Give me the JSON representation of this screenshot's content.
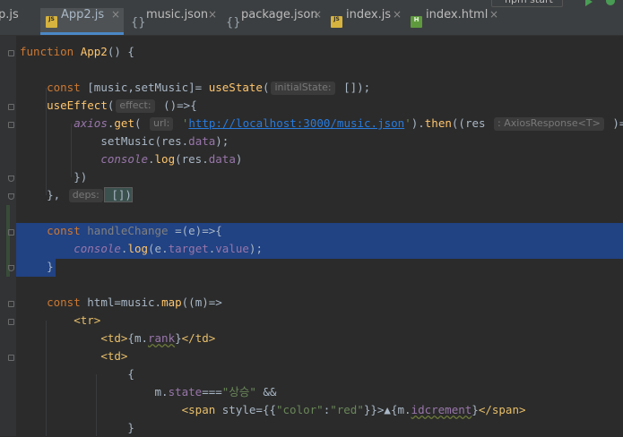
{
  "toolbar": {
    "run_config_label": "npm start"
  },
  "tabs": [
    {
      "label": "p.js",
      "icon": "js-file-icon",
      "active": false
    },
    {
      "label": "App2.js",
      "icon": "js-file-icon",
      "active": true
    },
    {
      "label": "music.json",
      "icon": "json-file-icon",
      "active": false
    },
    {
      "label": "package.json",
      "icon": "json-file-icon",
      "active": false
    },
    {
      "label": "index.js",
      "icon": "js-file-icon",
      "active": false
    },
    {
      "label": "index.html",
      "icon": "html-file-icon",
      "active": false
    }
  ],
  "tab_close_glyph": "×",
  "code": {
    "l1": {
      "kw": "function ",
      "fn": "App2",
      "rest": "() {"
    },
    "l3": {
      "kw": "const ",
      "vars": "[music,setMusic]= ",
      "fn": "useState",
      "open": "(",
      "hint": "initialState:",
      "rest": " []);"
    },
    "l4": {
      "fn": "useEffect",
      "open": "(",
      "hint": "effect:",
      "rest": " ()=>{"
    },
    "l5": {
      "obj": "axios",
      "dot": ".",
      "fn": "get",
      "open": "( ",
      "hint1": "url:",
      "q1": " '",
      "url": "http://localhost:3000/music.json",
      "q2": "'",
      "mid": ").",
      "fn2": "then",
      "mid2": "((res ",
      "hint2": ": AxiosResponse<T>",
      "rest": " )=>{"
    },
    "l6": {
      "call": "setMusic",
      "open": "(res.",
      "prop": "data",
      "rest": ");"
    },
    "l7": {
      "obj": "console",
      "dot": ".",
      "call": "log",
      "open": "(res.",
      "prop": "data",
      "rest": ")"
    },
    "l8": {
      "text": "})"
    },
    "l9": {
      "open": "}, ",
      "hint": "deps:",
      "rest": " [])"
    },
    "l11": {
      "kw": "const ",
      "name": "handleChange ",
      "rest": "=(e)=>{"
    },
    "l12": {
      "obj": "console",
      "dot": ".",
      "call": "log",
      "open": "(e.",
      "prop1": "target",
      "dot2": ".",
      "prop2": "value",
      "rest": ");"
    },
    "l13": {
      "text": "}"
    },
    "l15": {
      "kw": "const ",
      "vars": "html=music.",
      "fn": "map",
      "rest": "((m)=>"
    },
    "l16": {
      "tag": "<tr>"
    },
    "l17": {
      "tag1": "<td>",
      "expr": "{m.",
      "prop": "rank",
      "close": "}",
      "tag2": "</td>"
    },
    "l18": {
      "tag": "<td>"
    },
    "l19": {
      "text": "{"
    },
    "l20": {
      "obj": "m.",
      "prop": "state",
      "op": "===",
      "str": "\"상승\"",
      "rest": " &&"
    },
    "l21": {
      "tag1": "<span ",
      "attr": "style",
      "eq": "={{",
      "s1": "\"color\"",
      "colon": ":",
      "s2": "\"red\"",
      "close": "}}>▲{m.",
      "prop": "idcrement",
      "end": "}",
      "tag2": "</span>"
    },
    "l22": {
      "text": "}"
    }
  }
}
